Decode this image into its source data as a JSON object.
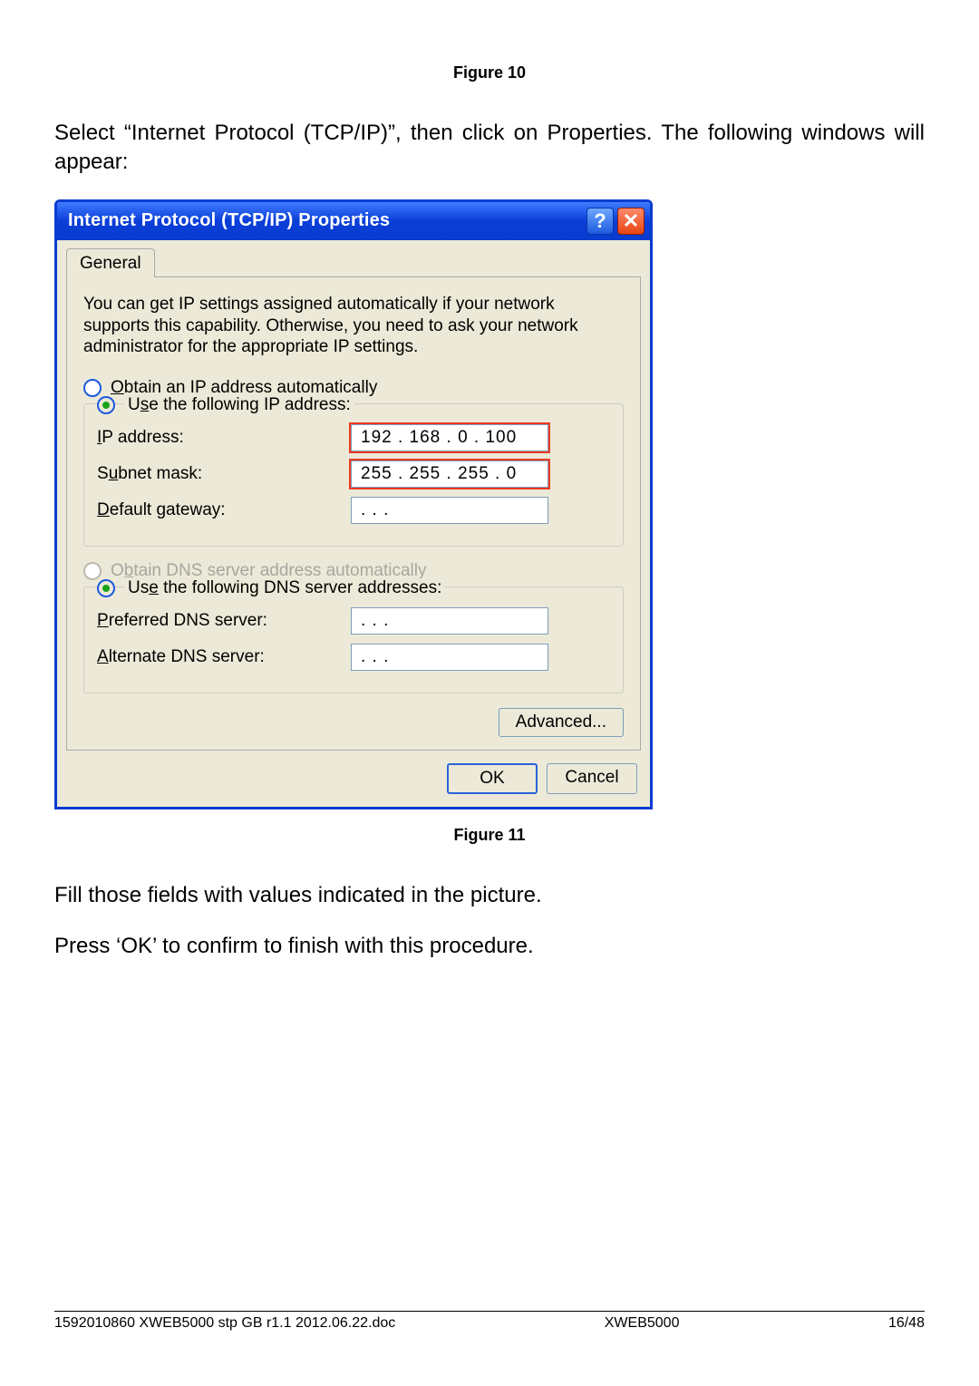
{
  "captions": {
    "fig10": "Figure 10",
    "fig11": "Figure 11"
  },
  "paragraphs": {
    "p1": "Select “Internet Protocol (TCP/IP)”, then click on Properties. The following windows will appear:",
    "p2": "Fill those fields with values indicated in the picture.",
    "p3": "Press ‘OK’ to confirm to finish with this procedure."
  },
  "dialog": {
    "title": "Internet Protocol (TCP/IP) Properties",
    "tab": "General",
    "intro": "You can get IP settings assigned automatically if your network supports this capability. Otherwise, you need to ask your network administrator for the appropriate IP settings.",
    "ip_group": {
      "radio_auto": "Obtain an IP address automatically",
      "radio_manual": "Use the following IP address:",
      "ip_label": "IP address:",
      "ip_value": "192 . 168 .   0   . 100",
      "subnet_label": "Subnet mask:",
      "subnet_value": "255 . 255 . 255 .   0",
      "gateway_label": "Default gateway:",
      "gateway_value": ".          .          ."
    },
    "dns_group": {
      "radio_auto": "Obtain DNS server address automatically",
      "radio_manual": "Use the following DNS server addresses:",
      "preferred_label": "Preferred DNS server:",
      "preferred_value": ".          .          .",
      "alternate_label": "Alternate DNS server:",
      "alternate_value": ".          .          ."
    },
    "buttons": {
      "advanced": "Advanced...",
      "ok": "OK",
      "cancel": "Cancel"
    }
  },
  "footer": {
    "left": "1592010860 XWEB5000 stp GB r1.1 2012.06.22.doc",
    "center": "XWEB5000",
    "right": "16/48"
  }
}
